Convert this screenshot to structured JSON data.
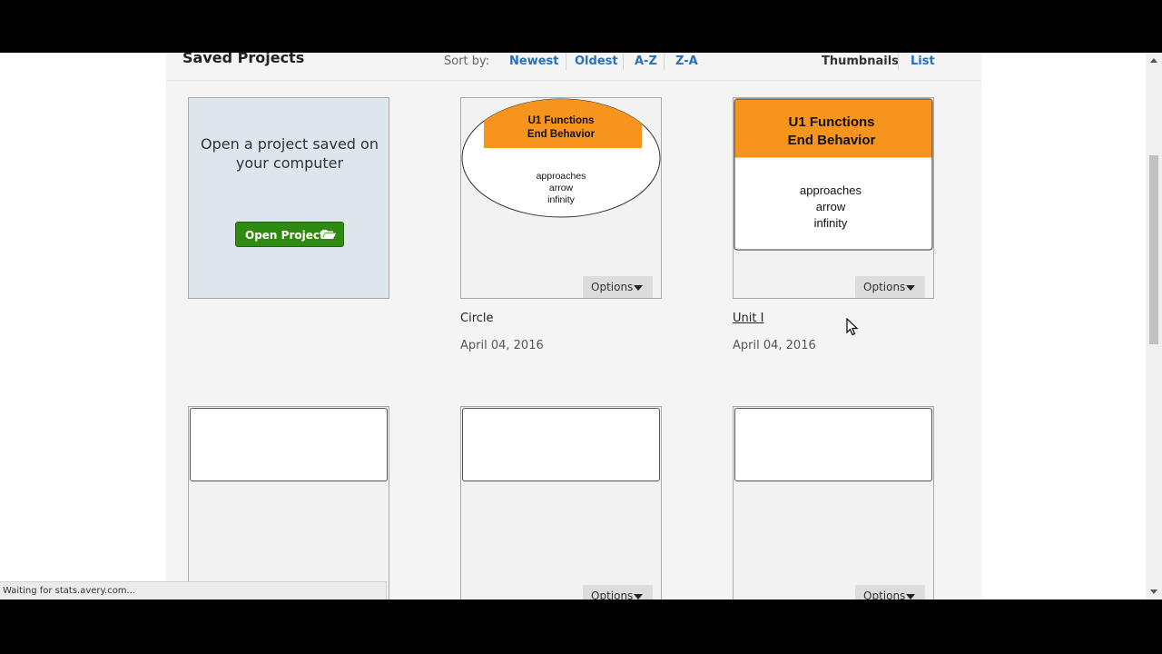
{
  "header": {
    "title": "Saved Projects",
    "sort_label": "Sort by:",
    "sort_options": [
      "Newest",
      "Oldest",
      "A-Z",
      "Z-A"
    ],
    "view_options": [
      "Thumbnails",
      "List"
    ]
  },
  "open_card": {
    "text": "Open a project saved on your computer",
    "button_label": "Open Project",
    "button_icon": "folder-open-icon"
  },
  "projects": [
    {
      "name": "Circle",
      "date": "April 04, 2016",
      "thumb": {
        "title_line1": "U1 Functions",
        "title_line2": "End Behavior",
        "body_lines": [
          "approaches",
          "arrow",
          "infinity"
        ],
        "shape": "ellipse"
      },
      "options_label": "Options"
    },
    {
      "name": "Unit I",
      "date": "April 04, 2016",
      "thumb": {
        "title_line1": "U1 Functions",
        "title_line2": "End Behavior",
        "body_lines": [
          "approaches",
          "arrow",
          "infinity"
        ],
        "shape": "rectangle"
      },
      "options_label": "Options"
    },
    {
      "options_label": "Options"
    },
    {
      "options_label": "Options"
    }
  ],
  "status_bar": "Waiting for stats.avery.com...",
  "colors": {
    "accent_orange": "#f7941d",
    "link_blue": "#2a70b8",
    "button_green": "#2f8a12"
  }
}
